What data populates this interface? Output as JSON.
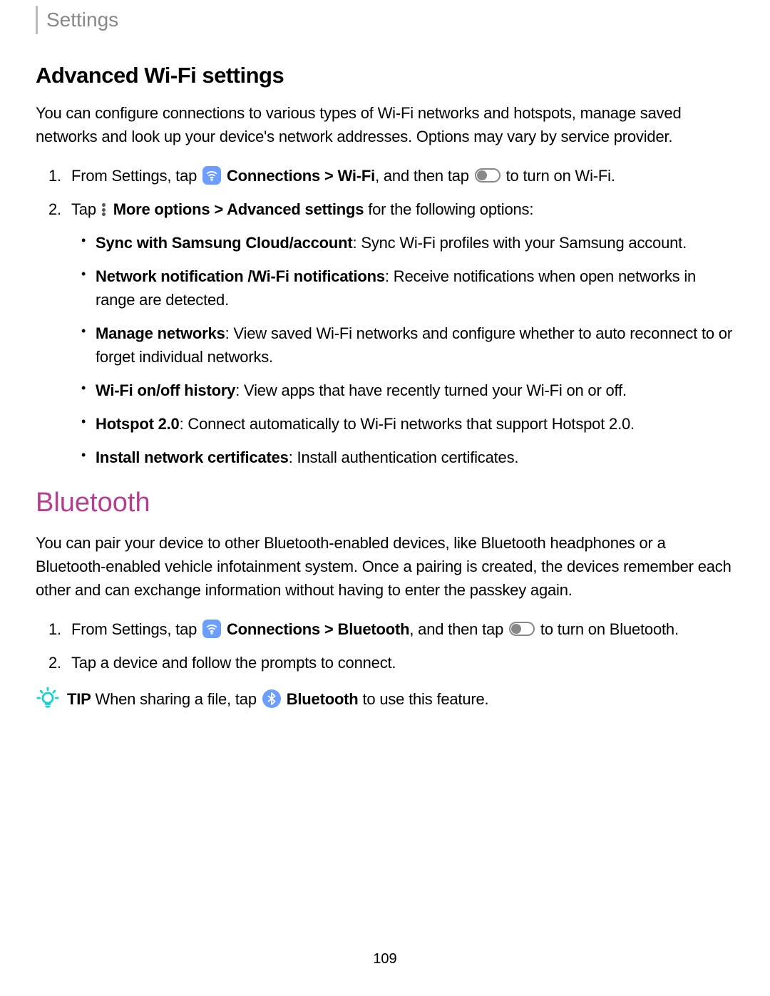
{
  "header": {
    "title": "Settings"
  },
  "wifi": {
    "heading": "Advanced Wi-Fi settings",
    "intro": "You can configure connections to various types of Wi-Fi networks and hotspots, manage saved networks and look up your device's network addresses. Options may vary by service provider.",
    "step1_pre": "From Settings, tap ",
    "connections_label": "Connections",
    "step1_mid": " > ",
    "wifi_label": "Wi-Fi",
    "step1_post1": ", and then tap ",
    "step1_post2": " to turn on Wi-Fi.",
    "step2_pre": "Tap ",
    "more_options_label": "More options",
    "step2_mid": " > ",
    "advanced_label": "Advanced settings",
    "step2_post": " for the following options:",
    "bullets": [
      {
        "title": "Sync with Samsung Cloud/account",
        "desc": ": Sync Wi-Fi profiles with your Samsung account."
      },
      {
        "title": "Network notification /Wi-Fi notifications",
        "desc": ": Receive notifications when open networks in range are detected."
      },
      {
        "title": "Manage networks",
        "desc": ": View saved Wi-Fi networks and configure whether to auto reconnect to or forget individual networks."
      },
      {
        "title": "Wi-Fi on/off history",
        "desc": ": View apps that have recently turned your Wi-Fi on or off."
      },
      {
        "title": "Hotspot 2.0",
        "desc": ": Connect automatically to Wi-Fi networks that support Hotspot 2.0."
      },
      {
        "title": "Install network certificates",
        "desc": ": Install authentication certificates."
      }
    ]
  },
  "bluetooth": {
    "heading": "Bluetooth",
    "intro": "You can pair your device to other Bluetooth-enabled devices, like Bluetooth headphones or a Bluetooth-enabled vehicle infotainment system. Once a pairing is created, the devices remember each other and can exchange information without having to enter the passkey again.",
    "step1_pre": "From Settings, tap ",
    "connections_label": "Connections",
    "step1_mid": " > ",
    "bt_label": "Bluetooth",
    "step1_post1": ", and then tap ",
    "step1_post2": " to turn on Bluetooth.",
    "step2": "Tap a device and follow the prompts to connect.",
    "tip_label": "TIP",
    "tip_pre": " When sharing a file, tap ",
    "tip_bt": "Bluetooth",
    "tip_post": " to use this feature."
  },
  "page_number": "109"
}
